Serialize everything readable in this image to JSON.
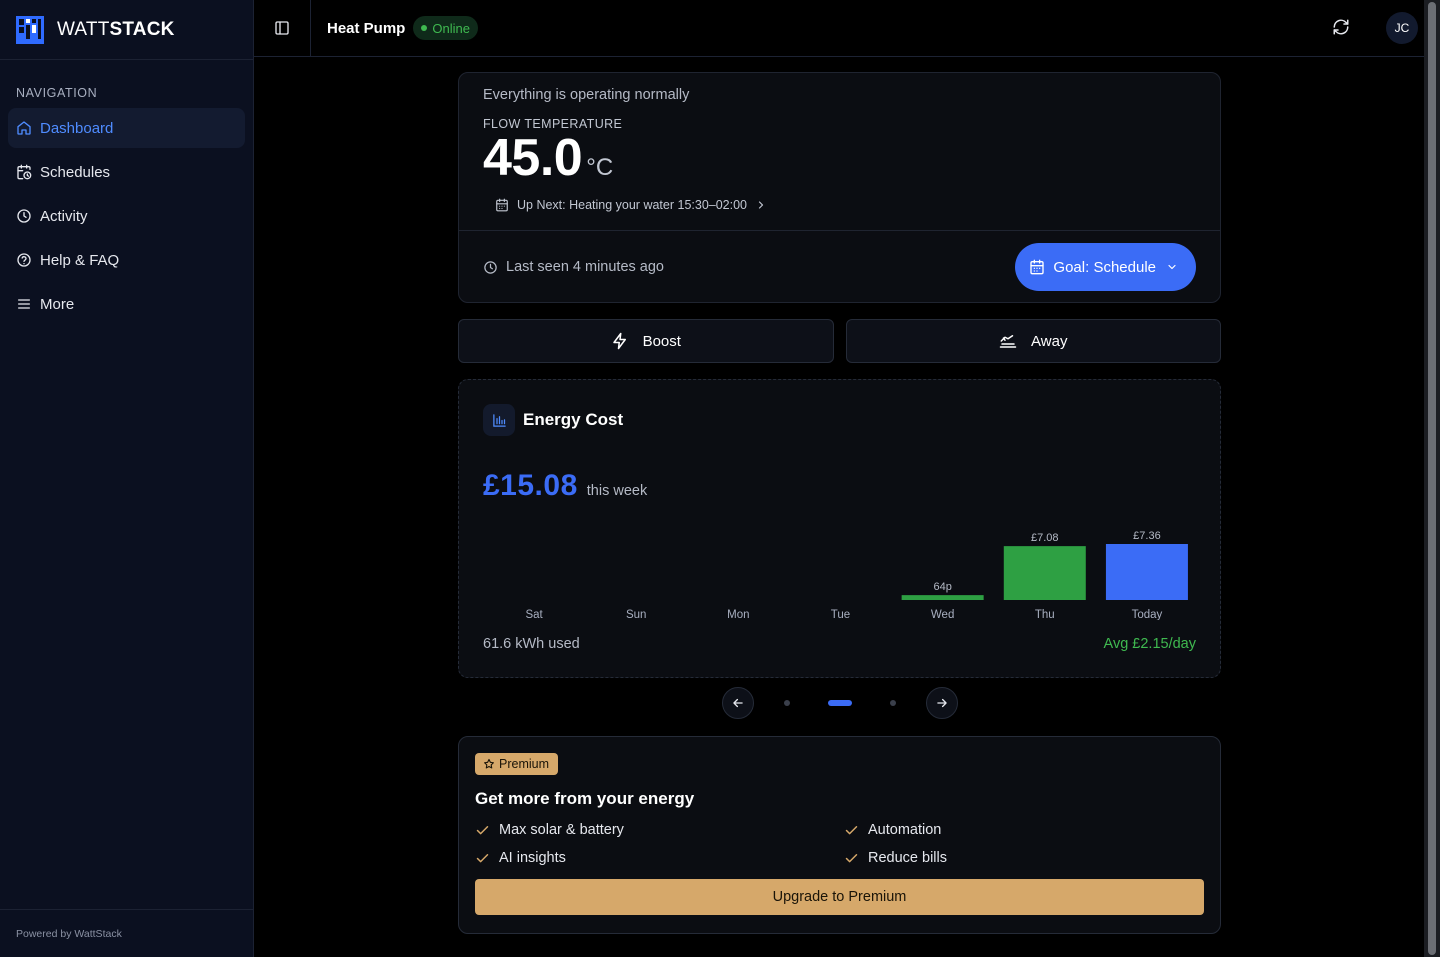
{
  "brand": {
    "name_regular": "WATT",
    "name_bold": "STACK"
  },
  "sidebar": {
    "section_title": "NAVIGATION",
    "items": [
      {
        "label": "Dashboard",
        "icon": "home-icon",
        "active": true
      },
      {
        "label": "Schedules",
        "icon": "calendar-clock-icon"
      },
      {
        "label": "Activity",
        "icon": "clock-icon"
      },
      {
        "label": "Help & FAQ",
        "icon": "help-circle-icon"
      },
      {
        "label": "More",
        "icon": "menu-icon"
      }
    ],
    "footer": "Powered by WattStack"
  },
  "topbar": {
    "device": "Heat Pump",
    "status": "Online",
    "avatar_initials": "JC"
  },
  "status_card": {
    "message": "Everything is operating normally",
    "flow_label": "FLOW TEMPERATURE",
    "temperature": "45.0",
    "unit": "°C",
    "up_next": "Up Next: Heating your water 15:30–02:00",
    "last_seen": "Last seen 4 minutes ago",
    "goal_label": "Goal: Schedule"
  },
  "actions": {
    "boost": "Boost",
    "away": "Away"
  },
  "energy": {
    "title": "Energy Cost",
    "total": "£15.08",
    "period": "this week",
    "used": "61.6 kWh used",
    "avg": "Avg £2.15/day"
  },
  "chart_data": {
    "type": "bar",
    "categories": [
      "Sat",
      "Sun",
      "Mon",
      "Tue",
      "Wed",
      "Thu",
      "Today"
    ],
    "values": [
      0,
      0,
      0,
      0,
      0.64,
      7.08,
      7.36
    ],
    "data_labels": [
      "",
      "",
      "",
      "",
      "64p",
      "£7.08",
      "£7.36"
    ],
    "colors": [
      "#2ea043",
      "#2ea043",
      "#2ea043",
      "#2ea043",
      "#2ea043",
      "#2ea043",
      "#3b6cf6"
    ],
    "ylim": [
      0,
      7.36
    ]
  },
  "premium": {
    "badge": "Premium",
    "title": "Get more from your energy",
    "features": [
      "Max solar & battery",
      "Automation",
      "AI insights",
      "Reduce bills"
    ],
    "cta": "Upgrade to Premium"
  },
  "colors": {
    "accent": "#3b6cf6",
    "online": "#3fb950",
    "premium": "#d6a86a",
    "bar_green": "#2ea043"
  }
}
